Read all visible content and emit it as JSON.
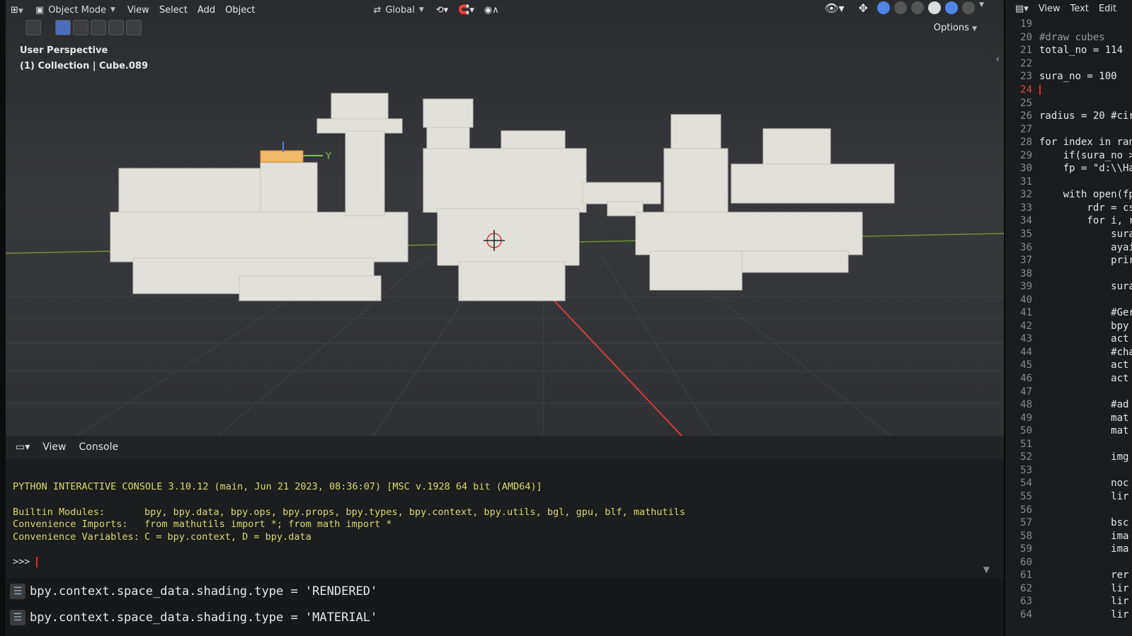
{
  "viewport": {
    "mode": "Object Mode",
    "menu": [
      "View",
      "Select",
      "Add",
      "Object"
    ],
    "orientation": "Global",
    "perspective_label": "User Perspective",
    "collection_label": "(1) Collection | Cube.089",
    "options_label": "Options",
    "gizmo_axis_y": "Y",
    "colors": {
      "bg": "#353639",
      "grid_red_axis": "#d63a3a",
      "grid_green_axis": "#7aa23a",
      "blocks": "#e4e2dc"
    }
  },
  "console": {
    "menu": [
      "View",
      "Console"
    ],
    "banner": "PYTHON INTERACTIVE CONSOLE 3.10.12 (main, Jun 21 2023, 08:36:07) [MSC v.1928 64 bit (AMD64)]",
    "rows": [
      {
        "key": "Builtin Modules:",
        "value": "bpy, bpy.data, bpy.ops, bpy.props, bpy.types, bpy.context, bpy.utils, bgl, gpu, blf, mathutils"
      },
      {
        "key": "Convenience Imports:",
        "value": "from mathutils import *; from math import *"
      },
      {
        "key": "Convenience Variables:",
        "value": "C = bpy.context, D = bpy.data"
      }
    ],
    "prompt": ">>>",
    "info_lines": [
      "bpy.context.space_data.shading.type = 'RENDERED'",
      "bpy.context.space_data.shading.type = 'MATERIAL'"
    ]
  },
  "editor": {
    "menu": [
      "View",
      "Text",
      "Edit"
    ],
    "lines": [
      {
        "n": "19",
        "code": ""
      },
      {
        "n": "20",
        "code": "#draw cubes"
      },
      {
        "n": "21",
        "code": "total_no = 114"
      },
      {
        "n": "22",
        "code": ""
      },
      {
        "n": "23",
        "code": "sura_no = 100"
      },
      {
        "n": "24",
        "code": ""
      },
      {
        "n": "25",
        "code": ""
      },
      {
        "n": "26",
        "code": "radius = 20 #cir"
      },
      {
        "n": "27",
        "code": ""
      },
      {
        "n": "28",
        "code": "for index in ran"
      },
      {
        "n": "29",
        "code": "    if(sura_no >"
      },
      {
        "n": "30",
        "code": "    fp = \"d:\\\\Ha"
      },
      {
        "n": "31",
        "code": ""
      },
      {
        "n": "32",
        "code": "    with open(fp"
      },
      {
        "n": "33",
        "code": "        rdr = cs"
      },
      {
        "n": "34",
        "code": "        for i, r"
      },
      {
        "n": "35",
        "code": "            sura"
      },
      {
        "n": "36",
        "code": "            ayai"
      },
      {
        "n": "37",
        "code": "            prir"
      },
      {
        "n": "38",
        "code": ""
      },
      {
        "n": "39",
        "code": "            sura"
      },
      {
        "n": "40",
        "code": ""
      },
      {
        "n": "41",
        "code": "            #Ger"
      },
      {
        "n": "42",
        "code": "            bpy"
      },
      {
        "n": "43",
        "code": "            act"
      },
      {
        "n": "44",
        "code": "            #cha"
      },
      {
        "n": "45",
        "code": "            act"
      },
      {
        "n": "46",
        "code": "            act"
      },
      {
        "n": "47",
        "code": ""
      },
      {
        "n": "48",
        "code": "            #ad"
      },
      {
        "n": "49",
        "code": "            mat"
      },
      {
        "n": "50",
        "code": "            mat"
      },
      {
        "n": "51",
        "code": ""
      },
      {
        "n": "52",
        "code": "            img"
      },
      {
        "n": "53",
        "code": ""
      },
      {
        "n": "54",
        "code": "            noc"
      },
      {
        "n": "55",
        "code": "            lir"
      },
      {
        "n": "56",
        "code": ""
      },
      {
        "n": "57",
        "code": "            bsc"
      },
      {
        "n": "58",
        "code": "            ima"
      },
      {
        "n": "59",
        "code": "            ima"
      },
      {
        "n": "60",
        "code": ""
      },
      {
        "n": "61",
        "code": "            rer"
      },
      {
        "n": "62",
        "code": "            lir"
      },
      {
        "n": "63",
        "code": "            lir"
      },
      {
        "n": "64",
        "code": "            lir"
      }
    ],
    "current_line": "24"
  }
}
